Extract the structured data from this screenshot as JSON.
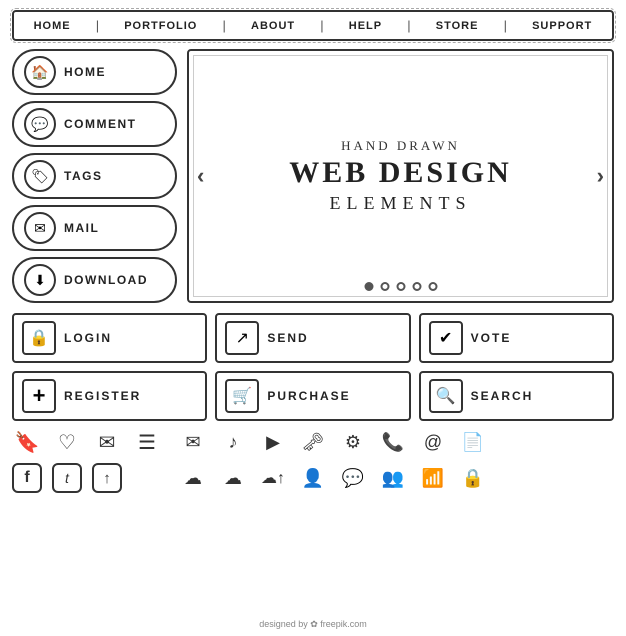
{
  "nav": {
    "items": [
      "HOME",
      "PORTFOLIO",
      "ABOUT",
      "HELP",
      "STORE",
      "SUPPORT"
    ]
  },
  "sidebar": {
    "items": [
      {
        "id": "home",
        "label": "HOME",
        "icon": "🏠"
      },
      {
        "id": "comment",
        "label": "COMMENT",
        "icon": "💬"
      },
      {
        "id": "tags",
        "label": "TAGS",
        "icon": "🏷"
      },
      {
        "id": "mail",
        "label": "MAIL",
        "icon": "✉"
      },
      {
        "id": "download",
        "label": "DOWNLOAD",
        "icon": "⬇"
      }
    ]
  },
  "hero": {
    "title_small": "HAND DRAWN",
    "title_large": "WEB DESIGN",
    "title_sub": "ELEMENTS"
  },
  "buttons": [
    {
      "id": "login",
      "label": "LOGIN",
      "icon": "🔒"
    },
    {
      "id": "send",
      "label": "SEND",
      "icon": "↗"
    },
    {
      "id": "vote",
      "label": "VOTE",
      "icon": "✔"
    },
    {
      "id": "register",
      "label": "REGISTER",
      "icon": "+"
    },
    {
      "id": "purchase",
      "label": "PURCHASE",
      "icon": "🛒"
    },
    {
      "id": "search",
      "label": "SEARCH",
      "icon": "🔍"
    }
  ],
  "icons_row1": [
    "🔖",
    "♡",
    "✉",
    "☰"
  ],
  "icons_row2": [
    "✉",
    "♪",
    "▶",
    "🗝",
    "⚙",
    "📞",
    "@",
    "📄"
  ],
  "icons_row3": [
    "f",
    "t",
    "↑"
  ],
  "icons_row4": [
    "☁",
    "☁",
    "☁",
    "👤",
    "💬",
    "👥",
    "📶",
    "🔒"
  ],
  "footer": {
    "text": "designed by ✿ freepik.com"
  }
}
